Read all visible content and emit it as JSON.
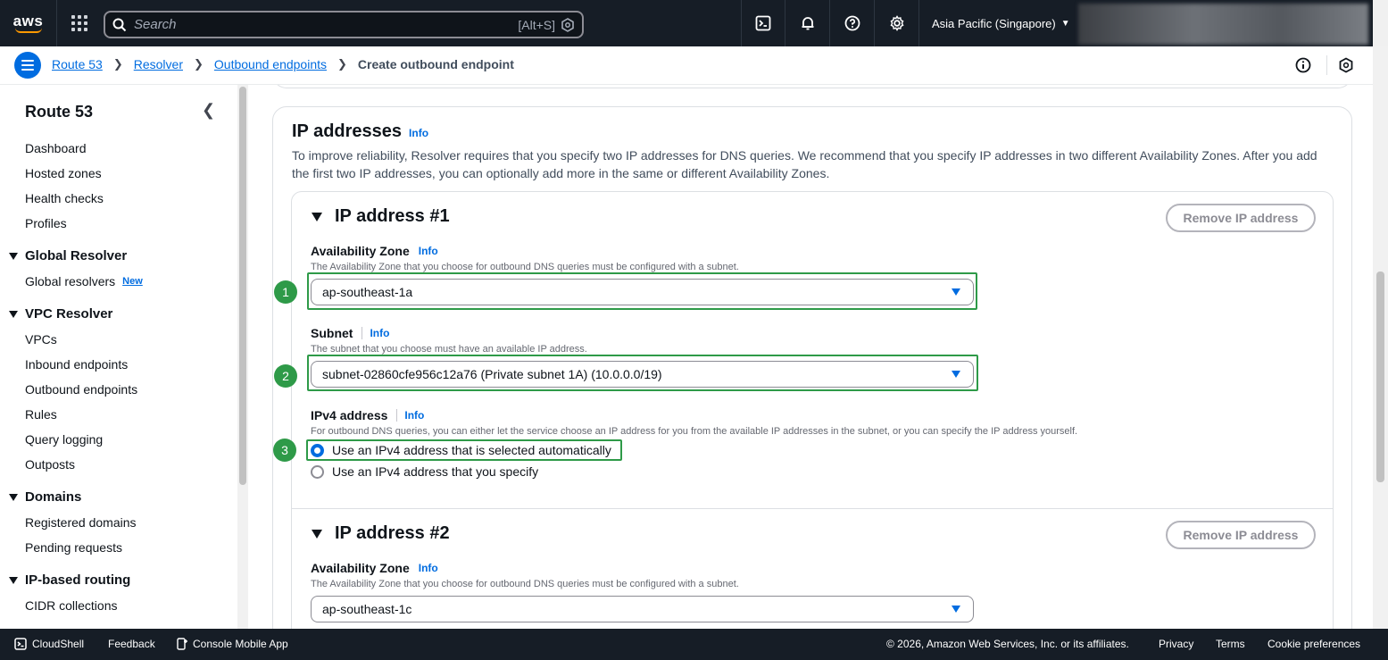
{
  "topnav": {
    "logo_text": "aws",
    "search_placeholder": "Search",
    "search_shortcut": "[Alt+S]",
    "region": "Asia Pacific (Singapore)",
    "icons": [
      "cloudshell-icon",
      "bell-icon",
      "help-icon",
      "settings-icon"
    ]
  },
  "breadcrumb": {
    "items": [
      "Route 53",
      "Resolver",
      "Outbound endpoints"
    ],
    "current": "Create outbound endpoint"
  },
  "sidebar": {
    "title": "Route 53",
    "links_top": [
      "Dashboard",
      "Hosted zones",
      "Health checks",
      "Profiles"
    ],
    "sections": [
      {
        "title": "Global Resolver",
        "items": [
          "Global resolvers"
        ]
      },
      {
        "title": "VPC Resolver",
        "items": [
          "VPCs",
          "Inbound endpoints",
          "Outbound endpoints",
          "Rules",
          "Query logging",
          "Outposts"
        ]
      },
      {
        "title": "Domains",
        "items": [
          "Registered domains",
          "Pending requests"
        ]
      },
      {
        "title": "IP-based routing",
        "items": [
          "CIDR collections"
        ]
      }
    ],
    "new_badge": "New"
  },
  "card": {
    "title": "IP addresses",
    "info": "Info",
    "description": "To improve reliability, Resolver requires that you specify two IP addresses for DNS queries. We recommend that you specify IP addresses in two different Availability Zones. After you add the first two IP addresses, you can optionally add more in the same or different Availability Zones."
  },
  "ip1": {
    "heading": "IP address #1",
    "remove_label": "Remove IP address",
    "az_label": "Availability Zone",
    "az_desc": "The Availability Zone that you choose for outbound DNS queries must be configured with a subnet.",
    "az_value": "ap-southeast-1a",
    "subnet_label": "Subnet",
    "subnet_desc": "The subnet that you choose must have an available IP address.",
    "subnet_value": "subnet-02860cfe956c12a76 (Private subnet 1A) (10.0.0.0/19)",
    "ipv4_label": "IPv4 address",
    "ipv4_desc": "For outbound DNS queries, you can either let the service choose an IP address for you from the available IP addresses in the subnet, or you can specify the IP address yourself.",
    "ipv4_option_auto": "Use an IPv4 address that is selected automatically",
    "ipv4_option_manual": "Use an IPv4 address that you specify",
    "ipv4_selected": "auto"
  },
  "ip2": {
    "heading": "IP address #2",
    "remove_label": "Remove IP address",
    "az_label": "Availability Zone",
    "az_desc": "The Availability Zone that you choose for outbound DNS queries must be configured with a subnet.",
    "az_value": "ap-southeast-1c"
  },
  "steps": [
    "1",
    "2",
    "3"
  ],
  "colors": {
    "accent": "#006ce0",
    "highlight": "#2e9a48",
    "nav_bg": "#161d26"
  },
  "footer": {
    "cloudshell": "CloudShell",
    "feedback": "Feedback",
    "mobile_app": "Console Mobile App",
    "copyright": "© 2026, Amazon Web Services, Inc. or its affiliates.",
    "privacy": "Privacy",
    "terms": "Terms",
    "cookies": "Cookie preferences"
  }
}
